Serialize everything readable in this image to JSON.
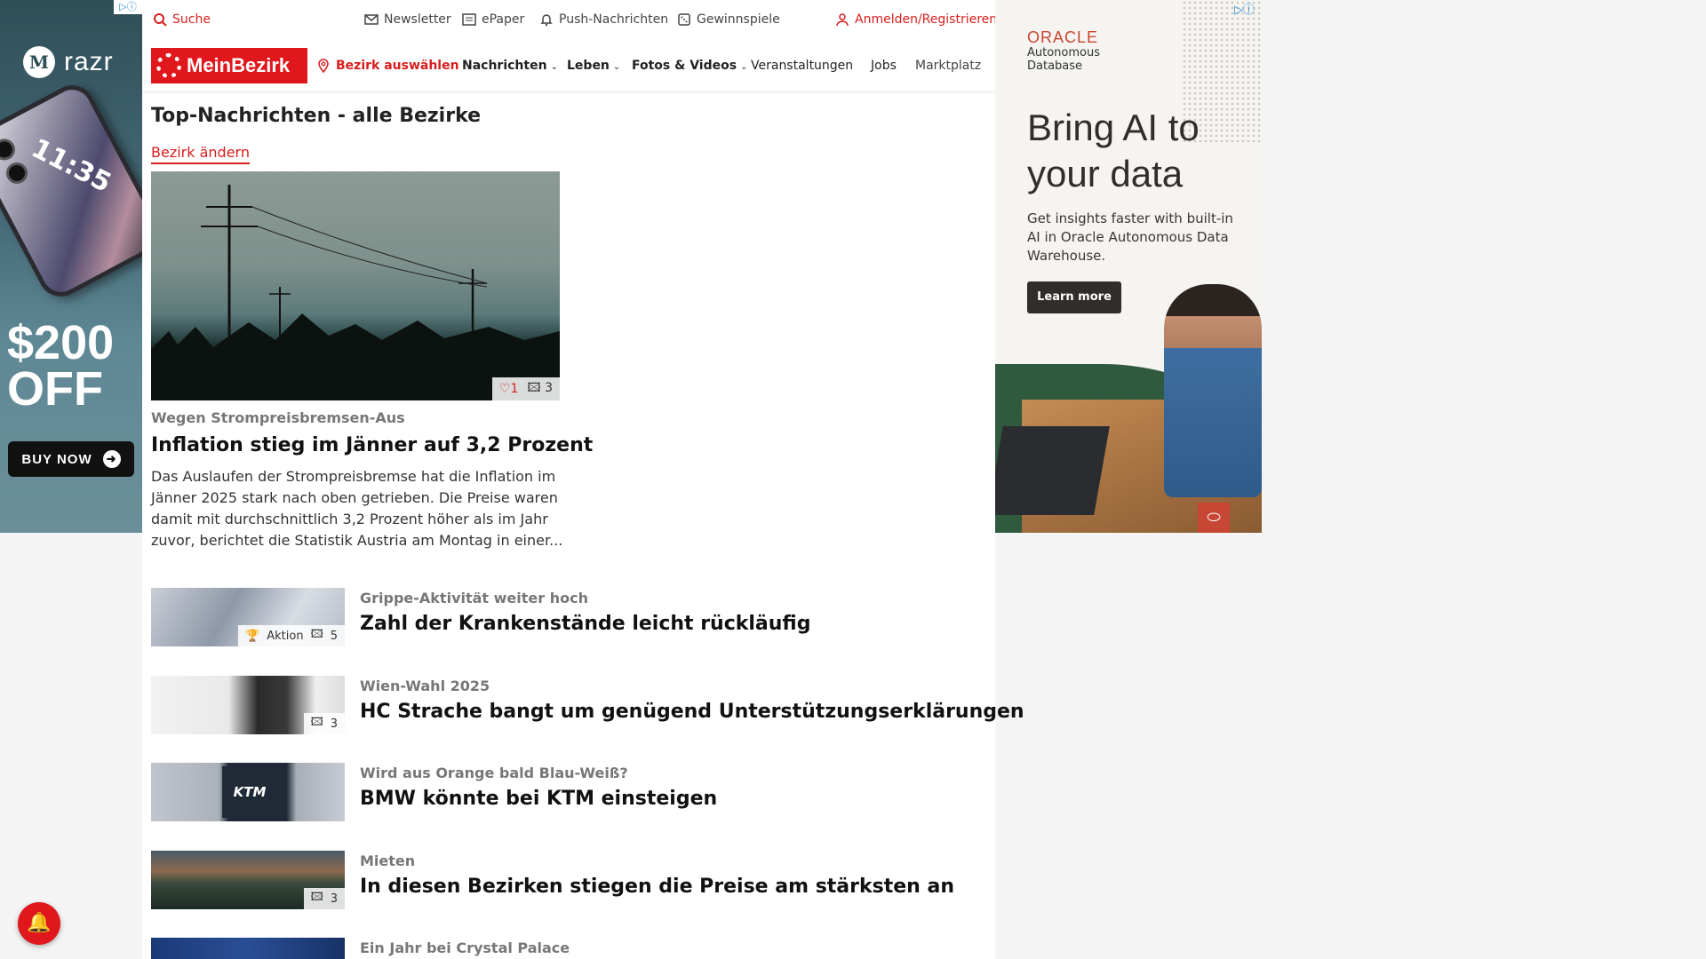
{
  "ad_left": {
    "adchoice": "▷ⓘ",
    "brand": "razr",
    "phone_time": "11:35",
    "price_line1": "$200",
    "price_line2": "OFF",
    "cta": "BUY NOW"
  },
  "topbar": {
    "search": "Suche",
    "newsletter": "Newsletter",
    "epaper": "ePaper",
    "push": "Push-Nachrichten",
    "gewinnspiele": "Gewinnspiele",
    "login": "Anmelden/Registrieren"
  },
  "nav": {
    "logo": "MeinBezirk",
    "bezirk": "Bezirk auswählen",
    "items": [
      {
        "label": "Nachrichten"
      },
      {
        "label": "Leben"
      },
      {
        "label": "Fotos & Videos"
      },
      {
        "label": "Veranstaltungen"
      },
      {
        "label": "Jobs"
      },
      {
        "label": "Marktplatz"
      }
    ]
  },
  "section": {
    "title": "Top-Nachrichten - alle Bezirke",
    "change": "Bezirk ändern"
  },
  "hero": {
    "likes": "1",
    "images": "3",
    "kicker": "Wegen Strompreisbremsen-Aus",
    "title": "Inflation stieg im Jänner auf 3,2 Prozent",
    "text": "Das Auslaufen der Strompreisbremse hat die Inflation im Jänner 2025 stark nach oben getrieben. Die Preise waren damit mit durchschnittlich 3,2 Prozent höher als im Jahr zuvor, berichtet die Statistik Austria am Montag in einer..."
  },
  "articles": [
    {
      "kicker": "Grippe-Aktivität weiter hoch",
      "title": "Zahl der Krankenstände leicht rückläufig",
      "badge_label": "Aktion",
      "images": "5"
    },
    {
      "kicker": "Wien-Wahl 2025",
      "title": "HC Strache bangt um genügend Unterstützungserklärungen",
      "images": "3"
    },
    {
      "kicker": "Wird aus Orange bald Blau-Weiß?",
      "title": "BMW könnte bei KTM einsteigen",
      "thumb_text": "KTM"
    },
    {
      "kicker": "Mieten",
      "title": "In diesen Bezirken stiegen die Preise am stärksten an",
      "images": "3"
    },
    {
      "kicker": "Ein Jahr bei Crystal Palace",
      "title": ""
    }
  ],
  "ad_right": {
    "adchoice": "▷ⓘ",
    "brand": "ORACLE",
    "sub": "Autonomous Database",
    "headline": "Bring AI to your data",
    "body": "Get insights faster with built-in AI in Oracle Autonomous Data Warehouse.",
    "cta": "Learn more"
  },
  "colors": {
    "brand_red": "#e0171c",
    "oracle_red": "#c74634"
  }
}
